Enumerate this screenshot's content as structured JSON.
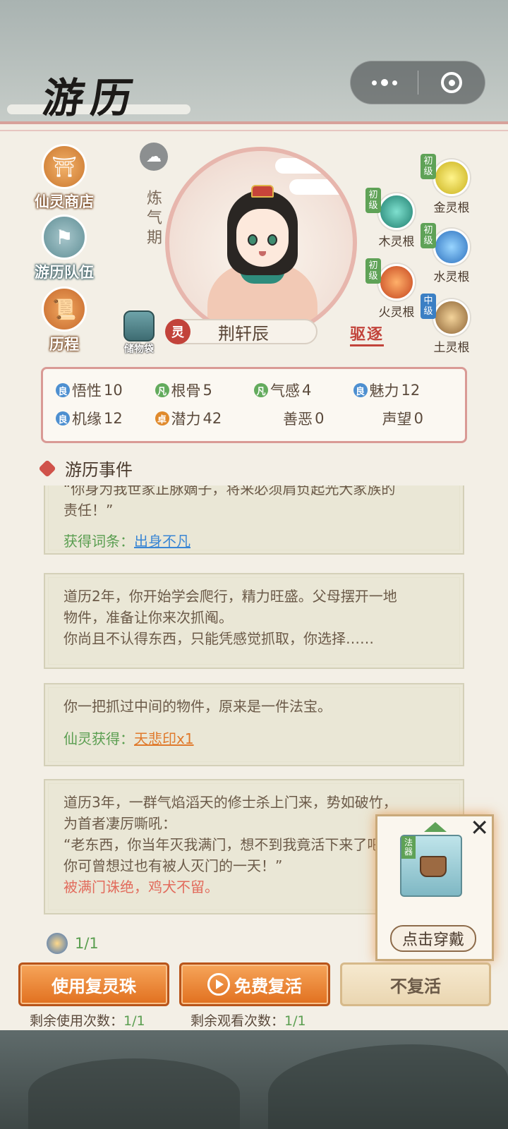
{
  "header": {
    "title": "游历"
  },
  "side_menu": [
    {
      "label": "仙灵商店",
      "icon": "shop-icon"
    },
    {
      "label": "游历队伍",
      "icon": "flag-icon"
    },
    {
      "label": "历程",
      "icon": "scroll-icon"
    }
  ],
  "character": {
    "realm": "炼气期",
    "name": "荆轩辰",
    "name_badge": "灵",
    "bag_label": "储物袋",
    "expel_label": "驱逐"
  },
  "spirit_roots": [
    {
      "grade": "初级",
      "label": "金灵根",
      "color": "#c9b01a"
    },
    {
      "grade": "初级",
      "label": "木灵根",
      "color": "#1e7d6d"
    },
    {
      "grade": "初级",
      "label": "水灵根",
      "color": "#2b6fbd"
    },
    {
      "grade": "初级",
      "label": "火灵根",
      "color": "#c4431d"
    },
    {
      "grade": "中级",
      "label": "土灵根",
      "color": "#8b6234"
    }
  ],
  "stats": {
    "row1": [
      {
        "q": "良",
        "name": "悟性",
        "value": "10"
      },
      {
        "q": "凡",
        "name": "根骨",
        "value": "5"
      },
      {
        "q": "凡",
        "name": "气感",
        "value": "4"
      },
      {
        "q": "良",
        "name": "魅力",
        "value": "12"
      }
    ],
    "row2": [
      {
        "q": "良",
        "name": "机缘",
        "value": "12"
      },
      {
        "q": "卓",
        "name": "潜力",
        "value": "42"
      },
      {
        "q": "",
        "name": "善恶",
        "value": "0"
      },
      {
        "q": "",
        "name": "声望",
        "value": "0"
      }
    ]
  },
  "events": {
    "heading": "游历事件",
    "cards": [
      {
        "lines": [
          "“你身为我世家正脉嫡子，将来必须肩负起光大家族的",
          "责任！”"
        ],
        "reward_label": "获得词条：",
        "reward": "出身不凡"
      },
      {
        "lines": [
          "道历2年，你开始学会爬行，精力旺盛。父母摆开一地",
          "物件，准备让你来次抓阄。",
          "你尚且不认得东西，只能凭感觉抓取，你选择……"
        ]
      },
      {
        "lines": [
          "你一把抓过中间的物件，原来是一件法宝。"
        ],
        "reward_label": "仙灵获得：",
        "reward": "天悲印x1"
      },
      {
        "lines": [
          "道历3年，一群气焰滔天的修士杀上门来，势如破竹，",
          "为首者凄厉嘶吼：",
          "“老东西，你当年灭我满门，想不到我竟活下来了吧！",
          "你可曾想过也有被人灭门的一天！”"
        ],
        "red_line": "被满门诛绝，鸡犬不留。"
      }
    ]
  },
  "popup": {
    "tag": "法器",
    "close": "✕",
    "button": "点击穿戴"
  },
  "revive": {
    "count": "1/1",
    "buttons": {
      "use_orb": "使用复灵珠",
      "free": "免费复活",
      "no": "不复活"
    },
    "remain_use_label": "剩余使用次数：",
    "remain_use": "1/1",
    "remain_watch_label": "剩余观看次数：",
    "remain_watch": "1/1"
  }
}
